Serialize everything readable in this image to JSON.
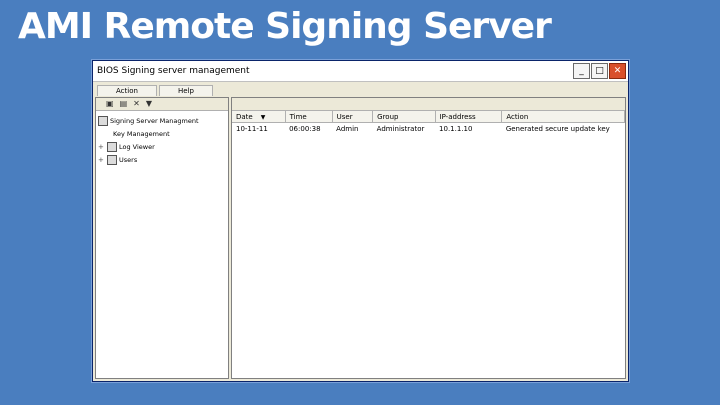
{
  "slide": {
    "title": "AMI Remote Signing Server"
  },
  "window": {
    "title": "BIOS Signing server management",
    "controls": {
      "minimize": "_",
      "maximize": "□",
      "close": "✕"
    }
  },
  "menu": {
    "items": [
      "Action",
      "Help"
    ]
  },
  "toolbar": {
    "icons": [
      "save-icon",
      "save-as-icon",
      "delete-icon",
      "filter-icon"
    ]
  },
  "tree": {
    "root": "Signing Server Managment",
    "children": [
      {
        "label": "Key Management",
        "expander": ""
      },
      {
        "label": "Log Viewer",
        "expander": "+"
      },
      {
        "label": "Users",
        "expander": "+"
      }
    ]
  },
  "log_table": {
    "columns": [
      "Date",
      "Time",
      "User",
      "Group",
      "IP-address",
      "Action"
    ],
    "sort_indicator": "▼",
    "rows": [
      [
        "10-11-11",
        "06:00:38",
        "Admin",
        "Administrator",
        "10.1.1.10",
        "Generated secure update key"
      ]
    ]
  }
}
